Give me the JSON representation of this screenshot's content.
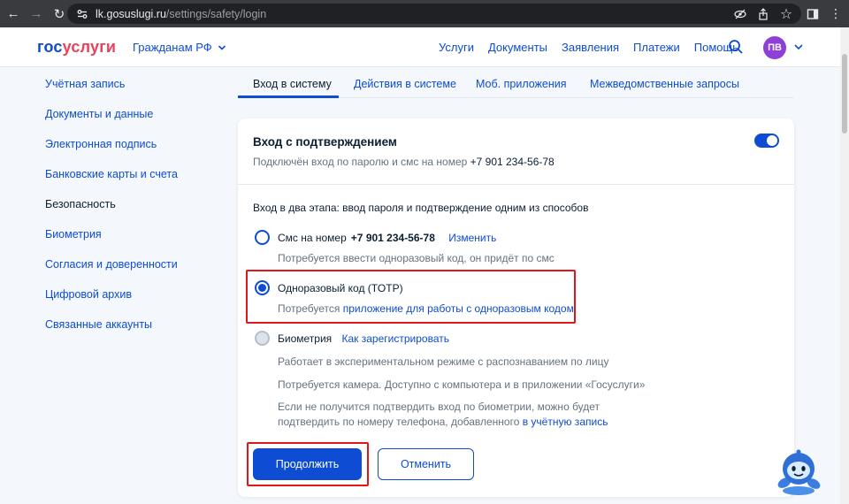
{
  "browser": {
    "url_host": "lk.gosuslugi.ru",
    "url_path": "/settings/safety/login"
  },
  "header": {
    "logo_part1": "гос",
    "logo_part2": "услуги",
    "citizens_label": "Гражданам РФ",
    "nav": [
      "Услуги",
      "Документы",
      "Заявления",
      "Платежи",
      "Помощь"
    ],
    "avatar_initials": "ПВ"
  },
  "sidebar": {
    "items": [
      {
        "label": "Учётная запись"
      },
      {
        "label": "Документы и данные"
      },
      {
        "label": "Электронная подпись"
      },
      {
        "label": "Банковские карты и счета"
      },
      {
        "label": "Безопасность"
      },
      {
        "label": "Биометрия"
      },
      {
        "label": "Согласия и доверенности"
      },
      {
        "label": "Цифровой архив"
      },
      {
        "label": "Связанные аккаунты"
      }
    ],
    "active": "Безопасность"
  },
  "tabs": [
    {
      "label": "Вход в систему"
    },
    {
      "label": "Действия в системе"
    },
    {
      "label": "Моб. приложения"
    },
    {
      "label": "Межведомственные запросы"
    }
  ],
  "card": {
    "title": "Вход с подтверждением",
    "subtitle_prefix": "Подключён вход по паролю и смс на номер",
    "phone": "+7 901 234-56-78",
    "toggle_on": true,
    "intro": "Вход в два этапа: ввод пароля и подтверждение одним из способов",
    "options": {
      "sms": {
        "label": "Смс на номер",
        "phone": "+7 901 234-56-78",
        "change_link": "Изменить",
        "hint": "Потребуется ввести одноразовый код, он придёт по смс"
      },
      "totp": {
        "label": "Одноразовый код (TOTP)",
        "hint_prefix": "Потребуется",
        "hint_link": "приложение для работы с одноразовым кодом"
      },
      "biometry": {
        "label": "Биометрия",
        "register_link": "Как зарегистрировать",
        "hint1": "Работает в экспериментальном режиме с распознаванием по лицу",
        "hint2": "Потребуется камера. Доступно с компьютера и в приложении «Госуслуги»",
        "hint3_line1": "Если не получится подтвердить вход по биометрии, можно будет",
        "hint3_line2_prefix": "подтвердить по номеру телефона, добавленного",
        "hint3_link": "в учётную запись"
      }
    },
    "selected_option": "totp",
    "buttons": {
      "continue": "Продолжить",
      "cancel": "Отменить"
    }
  },
  "colors": {
    "brand_blue": "#0d4cd3",
    "brand_red": "#ee3f58",
    "highlight_red": "#e0161b",
    "text_dark": "#0b1f33",
    "text_grey": "#66727f",
    "page_bg": "#f4f7fb",
    "avatar_bg": "#8e3fd8"
  }
}
